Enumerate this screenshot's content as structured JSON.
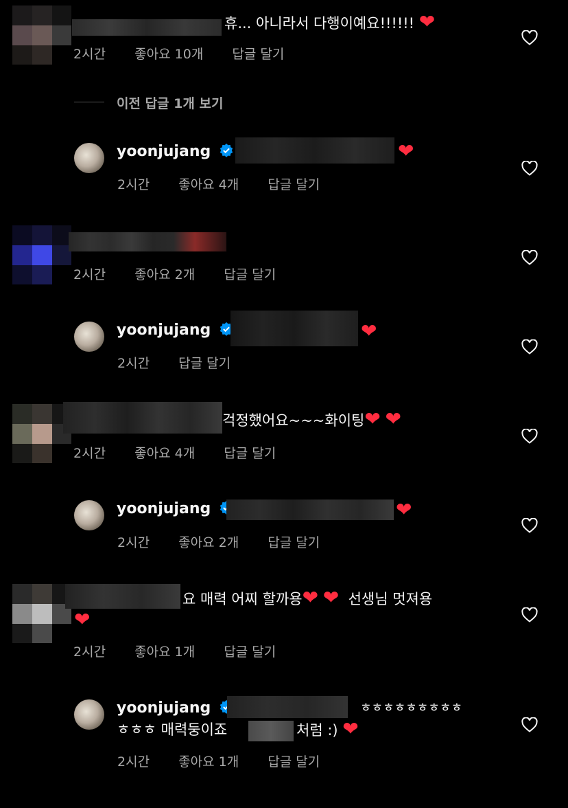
{
  "comments": [
    {
      "id": "c1",
      "text": "휴... 아니라서 다행이예요!!!!!!",
      "time": "2시간",
      "likes": "좋아요 10개",
      "reply": "답글 달기"
    },
    {
      "id": "r1",
      "username": "yoonjujang",
      "time": "2시간",
      "likes": "좋아요 4개",
      "reply": "답글 달기",
      "view_prev": "이전 답글 1개 보기"
    },
    {
      "id": "c2",
      "time": "2시간",
      "likes": "좋아요 2개",
      "reply": "답글 달기"
    },
    {
      "id": "r2",
      "username": "yoonjujang",
      "time": "2시간",
      "reply": "답글 달기"
    },
    {
      "id": "c3",
      "text": "걱정했어요~~~화이팅",
      "time": "2시간",
      "likes": "좋아요 4개",
      "reply": "답글 달기"
    },
    {
      "id": "r3",
      "username": "yoonjujang",
      "time": "2시간",
      "likes": "좋아요 2개",
      "reply": "답글 달기"
    },
    {
      "id": "c4",
      "text": "요 매력 어찌 할까용",
      "text2": "선생님 멋져용",
      "time": "2시간",
      "likes": "좋아요 1개",
      "reply": "답글 달기"
    },
    {
      "id": "r4",
      "username": "yoonjujang",
      "text_end": "ㅎㅎㅎㅎㅎㅎㅎㅎㅎ",
      "text_line2a": "ㅎㅎㅎ 매력둥이죠",
      "text_line2b": "처럼 :)",
      "time": "2시간",
      "likes": "좋아요 1개",
      "reply": "답글 달기"
    }
  ],
  "icons": {
    "heart_outline": "heart-outline-icon",
    "heart_emoji": "red-heart-emoji",
    "verified": "verified-badge-icon"
  },
  "colors": {
    "background": "#000000",
    "text": "#f5f5f5",
    "meta": "#a8a8a8",
    "heart": "#ff2d40",
    "verified": "#0095f6"
  }
}
